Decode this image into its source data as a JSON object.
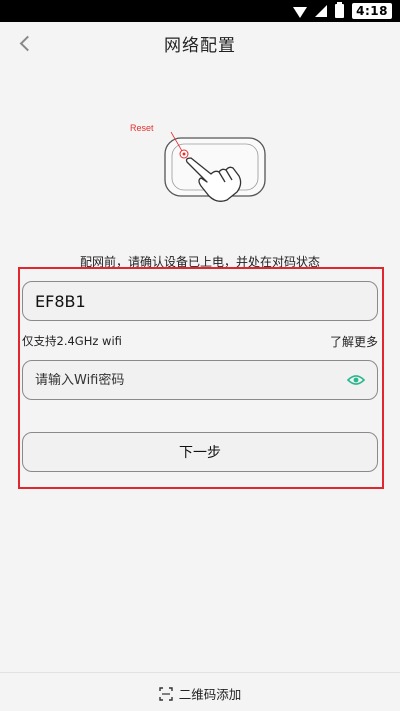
{
  "status_bar": {
    "time": "4:18"
  },
  "header": {
    "title": "网络配置"
  },
  "illustration": {
    "reset_label": "Reset"
  },
  "instruction": "配网前，请确认设备已上电，并处在对码状态",
  "form": {
    "ssid_value": "EF8B1",
    "support_note": "仅支持2.4GHz wifi",
    "learn_more_label": "了解更多",
    "password_placeholder": "请输入Wifi密码",
    "password_value": "",
    "next_label": "下一步"
  },
  "footer": {
    "qr_add_label": "二维码添加"
  },
  "colors": {
    "highlight": "#e0262e",
    "eye_icon": "#29b78e",
    "reset_label": "#e53030",
    "background": "#f4f4f4"
  },
  "icons": [
    "wifi-icon",
    "signal-icon",
    "battery-icon",
    "back-chevron-icon",
    "eye-icon",
    "qr-scan-icon",
    "pointing-hand-icon"
  ]
}
